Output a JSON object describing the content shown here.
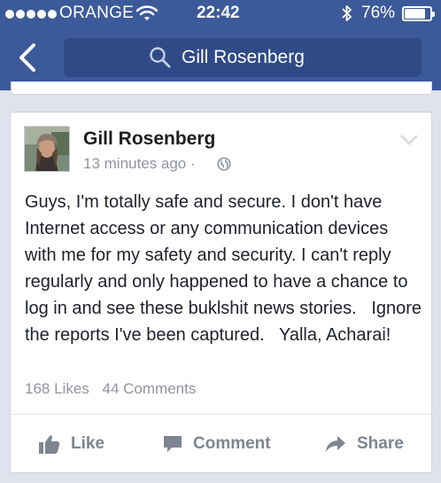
{
  "status_bar": {
    "carrier": "ORANGE",
    "time": "22:42",
    "battery": "76%",
    "battery_level": 0.76
  },
  "nav": {
    "search_text": "Gill Rosenberg",
    "icons": [
      "back-chevron-icon",
      "search-icon"
    ]
  },
  "post": {
    "author": "Gill Rosenberg",
    "time_ago": "13 minutes ago",
    "separator": "·",
    "privacy_icon": "globe-icon",
    "text": "Guys, I'm totally safe and secure. I don't have Internet access or any communication devices with me for my safety and security. I can't reply regularly and only happened to have a chance to log in and see these buklshit news stories.   Ignore the reports I've been captured.   Yalla, Acharai!",
    "likes": "168 Likes",
    "comments": "44 Comments"
  },
  "actions": {
    "like": "Like",
    "comment": "Comment",
    "share": "Share"
  },
  "colors": {
    "header": "#3c5a99",
    "search_box": "#2f4a86",
    "background": "#dfe3ee",
    "meta_text": "#90949c",
    "action_text": "#7f8590"
  }
}
